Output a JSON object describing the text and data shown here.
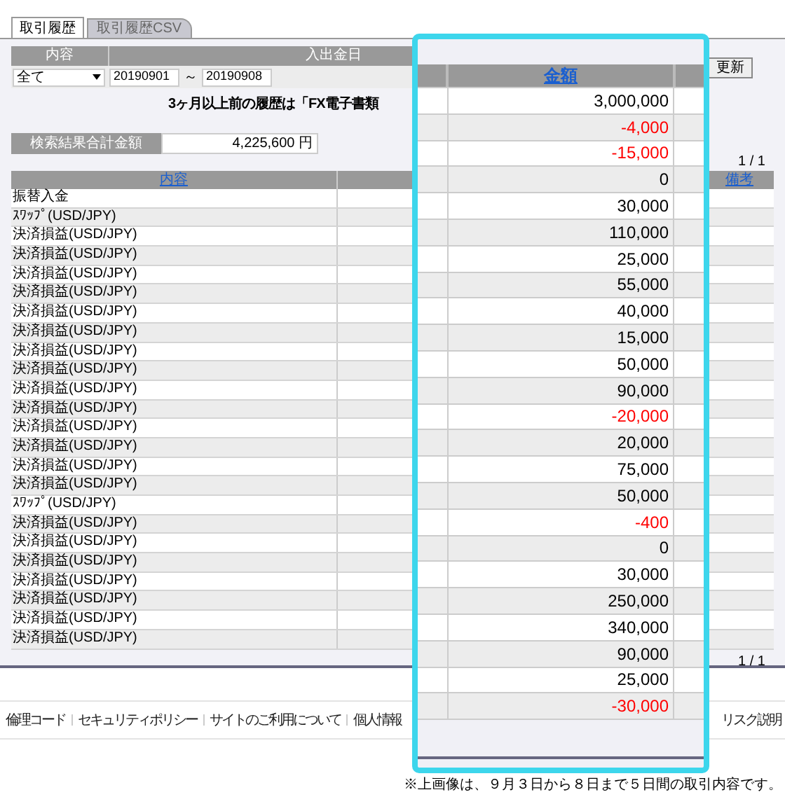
{
  "tabs": [
    {
      "label": "取引履歴",
      "selected": true
    },
    {
      "label": "取引履歴CSV",
      "selected": false
    }
  ],
  "filter": {
    "headers": [
      "内容",
      "入出金日"
    ],
    "select_value": "全て",
    "date_from": "20190901",
    "separator": "～",
    "date_to": "20190908",
    "button": "更新"
  },
  "notice": "3ヶ月以上前の履歴は「FX電子書類",
  "total": {
    "label": "検索結果合計金額",
    "value": "4,225,600 円"
  },
  "pagination_top": "1 / 1",
  "table": {
    "columns": [
      "内容",
      "備考"
    ],
    "rows": [
      {
        "content": "振替入金"
      },
      {
        "content": "ｽﾜｯﾌﾟ(USD/JPY)"
      },
      {
        "content": "決済損益(USD/JPY)"
      },
      {
        "content": "決済損益(USD/JPY)"
      },
      {
        "content": "決済損益(USD/JPY)"
      },
      {
        "content": "決済損益(USD/JPY)"
      },
      {
        "content": "決済損益(USD/JPY)"
      },
      {
        "content": "決済損益(USD/JPY)"
      },
      {
        "content": "決済損益(USD/JPY)"
      },
      {
        "content": "決済損益(USD/JPY)"
      },
      {
        "content": "決済損益(USD/JPY)"
      },
      {
        "content": "決済損益(USD/JPY)"
      },
      {
        "content": "決済損益(USD/JPY)"
      },
      {
        "content": "決済損益(USD/JPY)"
      },
      {
        "content": "決済損益(USD/JPY)"
      },
      {
        "content": "決済損益(USD/JPY)"
      },
      {
        "content": "ｽﾜｯﾌﾟ(USD/JPY)"
      },
      {
        "content": "決済損益(USD/JPY)"
      },
      {
        "content": "決済損益(USD/JPY)"
      },
      {
        "content": "決済損益(USD/JPY)"
      },
      {
        "content": "決済損益(USD/JPY)"
      },
      {
        "content": "決済損益(USD/JPY)"
      },
      {
        "content": "決済損益(USD/JPY)"
      },
      {
        "content": "決済損益(USD/JPY)"
      }
    ]
  },
  "pagination_bottom": "1 / 1",
  "callout": {
    "header": "金額",
    "amounts": [
      {
        "value": "3,000,000",
        "color": "#000000"
      },
      {
        "value": "-4,000",
        "color": "#ff0000"
      },
      {
        "value": "-15,000",
        "color": "#ff0000"
      },
      {
        "value": "0",
        "color": "#000000"
      },
      {
        "value": "30,000",
        "color": "#000000"
      },
      {
        "value": "110,000",
        "color": "#000000"
      },
      {
        "value": "25,000",
        "color": "#000000"
      },
      {
        "value": "55,000",
        "color": "#000000"
      },
      {
        "value": "40,000",
        "color": "#000000"
      },
      {
        "value": "15,000",
        "color": "#000000"
      },
      {
        "value": "50,000",
        "color": "#000000"
      },
      {
        "value": "90,000",
        "color": "#000000"
      },
      {
        "value": "-20,000",
        "color": "#ff0000"
      },
      {
        "value": "20,000",
        "color": "#000000"
      },
      {
        "value": "75,000",
        "color": "#000000"
      },
      {
        "value": "50,000",
        "color": "#000000"
      },
      {
        "value": "-400",
        "color": "#ff0000"
      },
      {
        "value": "0",
        "color": "#000000"
      },
      {
        "value": "30,000",
        "color": "#000000"
      },
      {
        "value": "250,000",
        "color": "#000000"
      },
      {
        "value": "340,000",
        "color": "#000000"
      },
      {
        "value": "90,000",
        "color": "#000000"
      },
      {
        "value": "25,000",
        "color": "#000000"
      },
      {
        "value": "-30,000",
        "color": "#ff0000"
      }
    ]
  },
  "footer_links": [
    "倫理コード",
    "セキュリティポリシー",
    "サイトのご利用について",
    "個人情報",
    "リスク説明"
  ],
  "note": "※上画像は、９月３日から８日まで５日間の取引内容です。"
}
